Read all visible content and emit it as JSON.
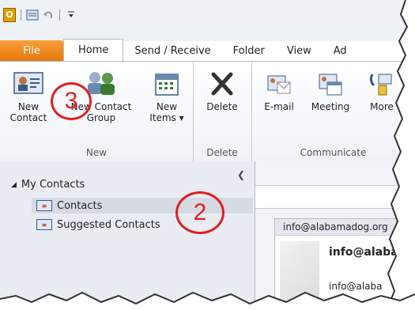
{
  "qat": {
    "app_letter": "O"
  },
  "tabs": [
    {
      "label": "File"
    },
    {
      "label": "Home"
    },
    {
      "label": "Send / Receive"
    },
    {
      "label": "Folder"
    },
    {
      "label": "View"
    },
    {
      "label": "Ad"
    }
  ],
  "ribbon": {
    "new_group": {
      "label": "New",
      "new_contact": "New\nContact",
      "new_contact_l1": "New",
      "new_contact_l2": "Contact",
      "new_group_l1": "New Contact",
      "new_group_l2": "Group",
      "new_items_l1": "New",
      "new_items_l2": "Items ▾"
    },
    "delete_group": {
      "label": "Delete",
      "delete": "Delete"
    },
    "communicate_group": {
      "label": "Communicate",
      "email": "E-mail",
      "meeting": "Meeting",
      "more": "More"
    }
  },
  "nav": {
    "header": "My Contacts",
    "items": [
      {
        "label": "Contacts"
      },
      {
        "label": "Suggested Contacts"
      }
    ]
  },
  "card": {
    "header": "info@alabamadog.org",
    "name": "info@alaba",
    "email": "info@alaba"
  },
  "annotations": {
    "step2": "2",
    "step3": "3"
  },
  "colors": {
    "file_tab": "#e8760a",
    "annotation": "#e02020",
    "selection": "#d6dbe3"
  }
}
